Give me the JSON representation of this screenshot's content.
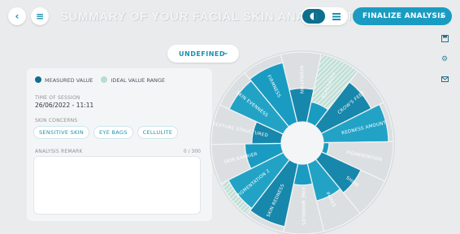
{
  "header": {
    "title": "SUMMARY OF YOUR FACIAL SKIN ANALYSIS TOUR",
    "finalize_label": "FINALIZE ANALYSIS"
  },
  "filter": {
    "selected": "UNDEFINED"
  },
  "legend": {
    "measured": "MEASURED VALUE",
    "ideal": "IDEAL VALUE RANGE"
  },
  "session": {
    "label": "TIME OF SESSION",
    "value": "26/06/2022 - 11:11"
  },
  "concerns": {
    "label": "SKIN CONCERNS",
    "chips": [
      "SENSITIVE SKIN",
      "EYE BAGS",
      "CELLULITE"
    ]
  },
  "remark": {
    "label": "ANALYSIS REMARK",
    "count": "0 / 300"
  },
  "colors": {
    "accent": "#1a9cc2",
    "measured": "#1a9cc2",
    "ideal": "#b8dcd2",
    "background": "#e9ebec"
  },
  "icons": [
    "back-icon",
    "menu-icon",
    "face-icon",
    "list-icon",
    "save-icon",
    "settings-icon",
    "mail-icon"
  ],
  "wheel": {
    "categories": [
      {
        "label": "ELASTICITY",
        "measured": 0.3,
        "ideal": true
      },
      {
        "label": "CROW'S FEET",
        "measured": 0.8,
        "ideal": false
      },
      {
        "label": "REDNESS AMOUNT",
        "measured": 0.93,
        "ideal": false
      },
      {
        "label": "PIGMENTATION",
        "measured": 0.08,
        "ideal": false
      },
      {
        "label": "SHINE",
        "measured": 0.62,
        "ideal": false
      },
      {
        "label": "PORES",
        "measured": 0.55,
        "ideal": false
      },
      {
        "label": "FINE WRINKLES",
        "measured": 0.3,
        "ideal": false
      },
      {
        "label": "SKIN REDNESS",
        "measured": 0.92,
        "ideal": false
      },
      {
        "label": "PIGMENTATION 2",
        "measured": 0.88,
        "ideal": true
      },
      {
        "label": "SKIN BARRIER",
        "measured": 0.52,
        "ideal": false
      },
      {
        "label": "TEXTURE STRUCTURED",
        "measured": 0.42,
        "ideal": false
      },
      {
        "label": "SKIN EVENNESS",
        "measured": 0.85,
        "ideal": false
      },
      {
        "label": "FIRMNESS",
        "measured": 0.88,
        "ideal": false
      },
      {
        "label": "HYDRATION",
        "measured": 0.48,
        "ideal": false
      }
    ]
  }
}
